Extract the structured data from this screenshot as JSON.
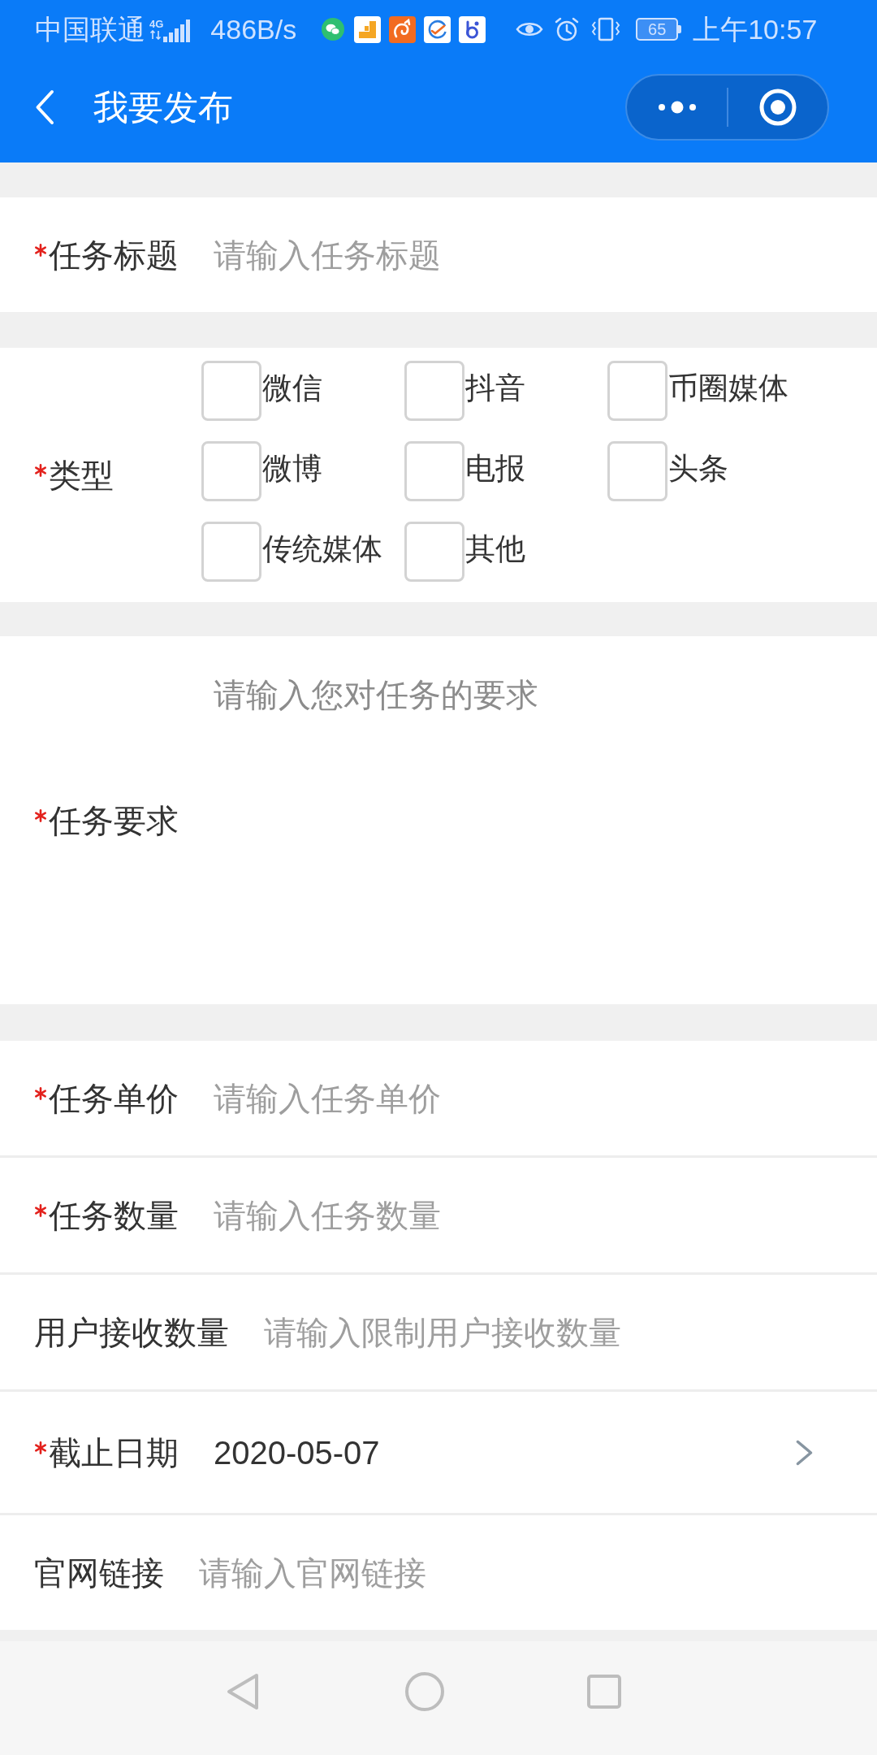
{
  "status_bar": {
    "carrier": "中国联通",
    "network": "4G",
    "speed": "486B/s",
    "battery": "65",
    "time": "上午10:57"
  },
  "title_bar": {
    "title": "我要发布"
  },
  "sections": [
    {
      "rows": [
        {
          "kind": "input",
          "label": "任务标题",
          "required": true,
          "placeholder": "请输入任务标题"
        }
      ]
    },
    {
      "rows": [
        {
          "kind": "checkboxes",
          "label": "类型",
          "required": true,
          "options": [
            {
              "label": "微信",
              "checked": false
            },
            {
              "label": "抖音",
              "checked": false
            },
            {
              "label": "币圈媒体",
              "checked": false
            },
            {
              "label": "微博",
              "checked": false
            },
            {
              "label": "电报",
              "checked": false
            },
            {
              "label": "头条",
              "checked": false
            },
            {
              "label": "传统媒体",
              "checked": false
            },
            {
              "label": "其他",
              "checked": false
            }
          ]
        }
      ]
    },
    {
      "rows": [
        {
          "kind": "textarea",
          "label": "任务要求",
          "required": true,
          "placeholder": "请输入您对任务的要求"
        }
      ]
    },
    {
      "rows": [
        {
          "kind": "input",
          "label": "任务单价",
          "required": true,
          "placeholder": "请输入任务单价"
        },
        {
          "kind": "input",
          "label": "任务数量",
          "required": true,
          "placeholder": "请输入任务数量"
        },
        {
          "kind": "input",
          "label": "用户接收数量",
          "required": false,
          "placeholder": "请输入限制用户接收数量"
        },
        {
          "kind": "picker",
          "label": "截止日期",
          "required": true,
          "value": "2020-05-07"
        },
        {
          "kind": "input",
          "label": "官网链接",
          "required": false,
          "placeholder": "请输入官网链接"
        }
      ]
    }
  ]
}
